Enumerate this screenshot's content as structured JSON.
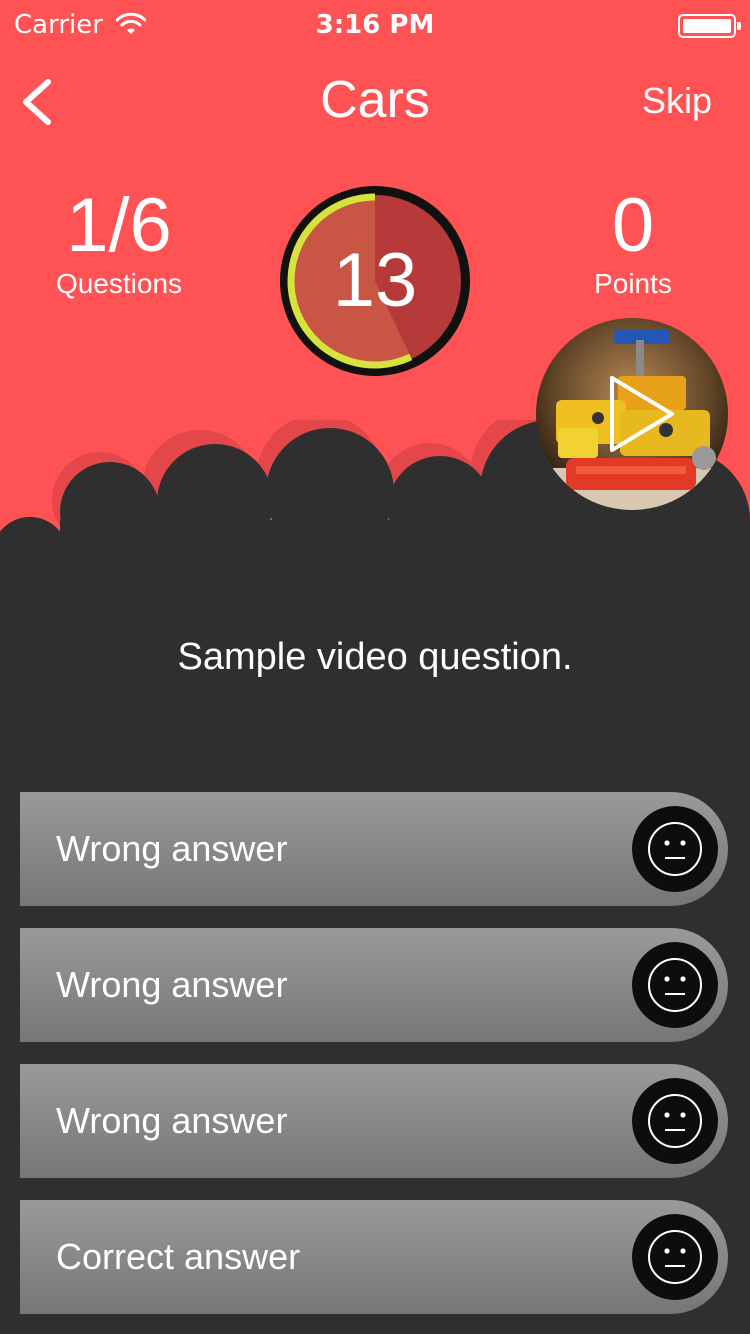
{
  "status_bar": {
    "carrier": "Carrier",
    "time": "3:16 PM"
  },
  "nav": {
    "title": "Cars",
    "skip_label": "Skip"
  },
  "stats": {
    "questions_value": "1/6",
    "questions_label": "Questions",
    "timer_value": "13",
    "timer_remaining_fraction": 0.43,
    "points_value": "0",
    "points_label": "Points"
  },
  "question": {
    "text": "Sample video question."
  },
  "answers": [
    {
      "label": "Wrong answer",
      "icon": "neutral-face-icon"
    },
    {
      "label": "Wrong answer",
      "icon": "neutral-face-icon"
    },
    {
      "label": "Wrong answer",
      "icon": "neutral-face-icon"
    },
    {
      "label": "Correct answer",
      "icon": "neutral-face-icon"
    }
  ],
  "colors": {
    "header": "#fe5254",
    "background": "#2f2f2f",
    "timer_elapsed": "#c95544",
    "timer_remaining": "#b73a3b",
    "timer_accent": "#d6e33c"
  }
}
